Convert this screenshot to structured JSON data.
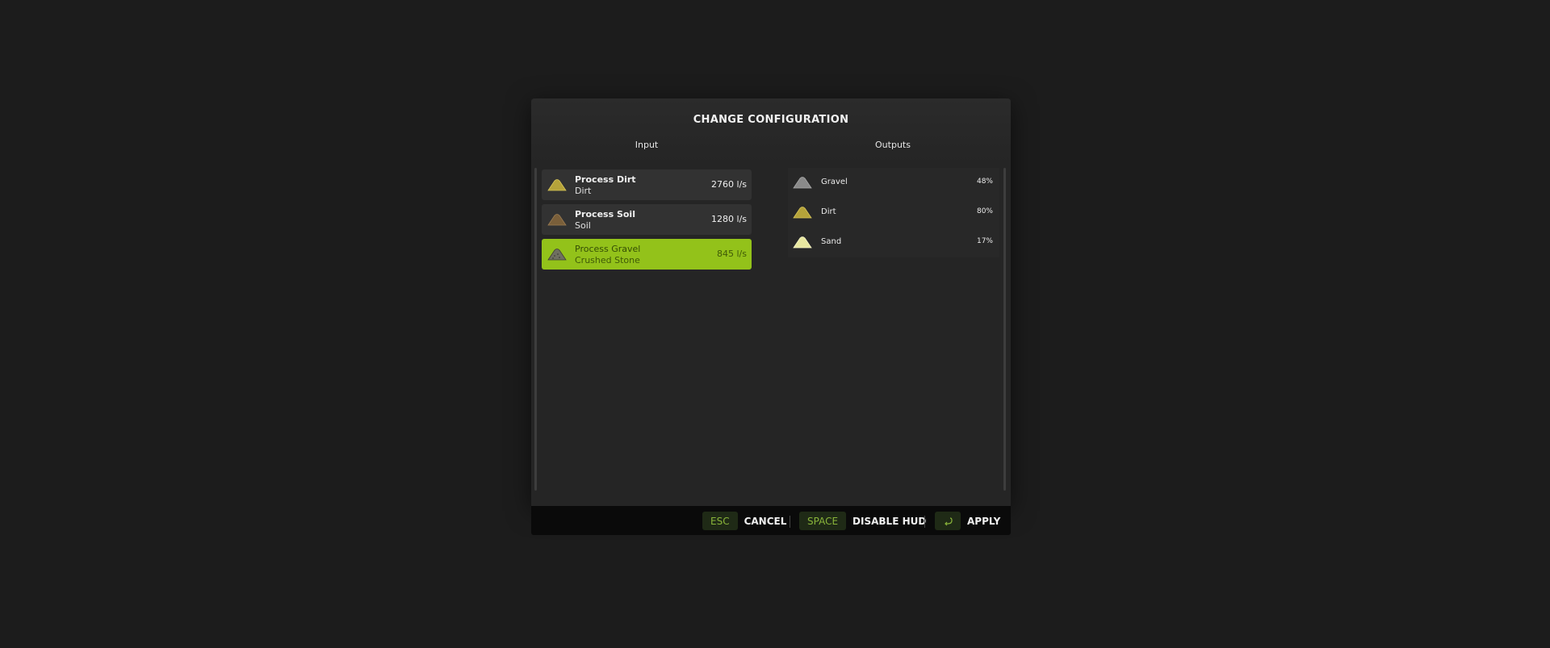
{
  "dialog": {
    "title": "CHANGE CONFIGURATION",
    "input_header": "Input",
    "output_header": "Outputs"
  },
  "inputs": [
    {
      "name": "Process Dirt",
      "material": "Dirt",
      "rate": "2760 l/s",
      "icon": "dirt-pile-icon",
      "color": "#b5a33a",
      "selected": false
    },
    {
      "name": "Process Soil",
      "material": "Soil",
      "rate": "1280 l/s",
      "icon": "soil-pile-icon",
      "color": "#7a5f3a",
      "selected": false
    },
    {
      "name": "Process Gravel",
      "material": "Crushed Stone",
      "rate": "845 l/s",
      "icon": "gravel-pile-icon",
      "color": "#6f6f60",
      "selected": true
    }
  ],
  "outputs": [
    {
      "name": "Gravel",
      "percent": "48%",
      "icon": "gravel-pile-icon",
      "color": "#8a8a8a"
    },
    {
      "name": "Dirt",
      "percent": "80%",
      "icon": "dirt-pile-icon",
      "color": "#b5a33a"
    },
    {
      "name": "Sand",
      "percent": "17%",
      "icon": "sand-pile-icon",
      "color": "#e8e7a0"
    }
  ],
  "footer": {
    "cancel_key": "ESC",
    "cancel_label": "CANCEL",
    "hud_key": "SPACE",
    "hud_label": "DISABLE HUD",
    "apply_icon": "enter-key-icon",
    "apply_label": "APPLY"
  },
  "colors": {
    "accent": "#93c21a",
    "key_text": "#89b43a"
  }
}
